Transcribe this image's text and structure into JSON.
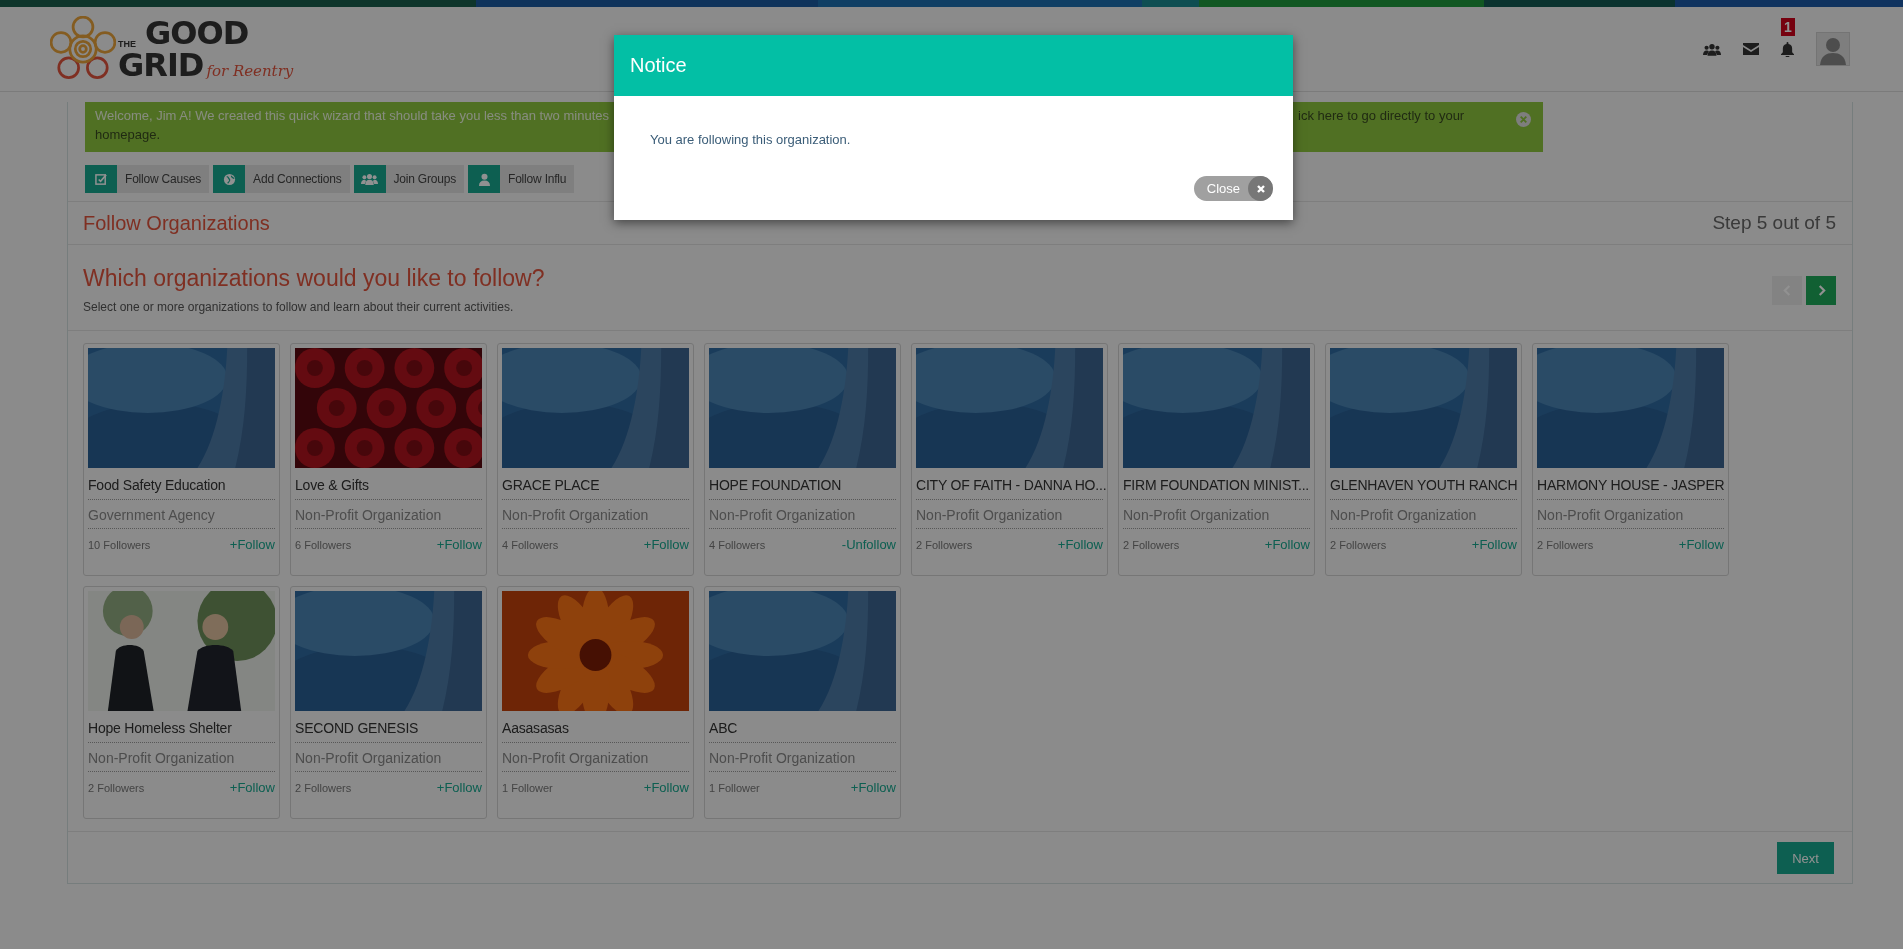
{
  "logo": {
    "the": "THE",
    "top": "GOOD",
    "bottom": "GRID",
    "tagline": "for Reentry"
  },
  "header": {
    "notification_count": "1"
  },
  "banner": {
    "text_start": "Welcome, Jim A! We created this quick wizard that should take you less than two minutes",
    "text_end": "ick here to go directly to your",
    "text_line2": "homepage."
  },
  "wizard_steps": [
    {
      "label": "Follow Causes"
    },
    {
      "label": "Add Connections"
    },
    {
      "label": "Join Groups"
    },
    {
      "label": "Follow Influ"
    }
  ],
  "page_title": "Follow Organizations",
  "step_indicator": "Step 5 out of 5",
  "question": "Which organizations would you like to follow?",
  "subtitle": "Select one or more organizations to follow and learn about their current activities.",
  "pager": {
    "prev_disabled": true,
    "next_disabled": false
  },
  "organizations": [
    {
      "name": "Food Safety Education",
      "type": "Government Agency",
      "followers": "10 Followers",
      "action": "+Follow"
    },
    {
      "name": "Love & Gifts",
      "type": "Non-Profit Organization",
      "followers": "6 Followers",
      "action": "+Follow"
    },
    {
      "name": "GRACE PLACE",
      "type": "Non-Profit Organization",
      "followers": "4 Followers",
      "action": "+Follow"
    },
    {
      "name": "HOPE FOUNDATION",
      "type": "Non-Profit Organization",
      "followers": "4 Followers",
      "action": "-Unfollow"
    },
    {
      "name": "CITY OF FAITH - DANNA HO...",
      "type": "Non-Profit Organization",
      "followers": "2 Followers",
      "action": "+Follow"
    },
    {
      "name": "FIRM FOUNDATION MINIST...",
      "type": "Non-Profit Organization",
      "followers": "2 Followers",
      "action": "+Follow"
    },
    {
      "name": "GLENHAVEN YOUTH RANCH",
      "type": "Non-Profit Organization",
      "followers": "2 Followers",
      "action": "+Follow"
    },
    {
      "name": "HARMONY HOUSE - JASPER",
      "type": "Non-Profit Organization",
      "followers": "2 Followers",
      "action": "+Follow"
    },
    {
      "name": "Hope Homeless Shelter",
      "type": "Non-Profit Organization",
      "followers": "2 Followers",
      "action": "+Follow"
    },
    {
      "name": "SECOND GENESIS",
      "type": "Non-Profit Organization",
      "followers": "2 Followers",
      "action": "+Follow"
    },
    {
      "name": "Aasasasas",
      "type": "Non-Profit Organization",
      "followers": "1 Follower",
      "action": "+Follow"
    },
    {
      "name": "ABC",
      "type": "Non-Profit Organization",
      "followers": "1 Follower",
      "action": "+Follow"
    }
  ],
  "next_button": "Next",
  "modal": {
    "title": "Notice",
    "message": "You are following this organization.",
    "close_button": "Close"
  }
}
